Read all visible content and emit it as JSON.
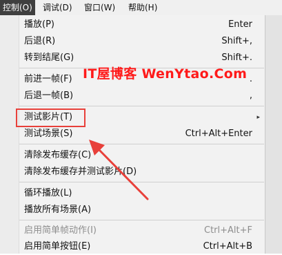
{
  "menubar": {
    "items": [
      {
        "label": "控制(O)",
        "active": true
      },
      {
        "label": "调试(D)"
      },
      {
        "label": "窗口(W)"
      },
      {
        "label": "帮助(H)"
      }
    ]
  },
  "menu": {
    "items": [
      {
        "label": "播放(P)",
        "shortcut": "Enter"
      },
      {
        "label": "后退(R)",
        "shortcut": "Shift+,"
      },
      {
        "label": "转到结尾(G)",
        "shortcut": "Shift+."
      },
      {
        "label": "前进一帧(F)",
        "shortcut": "."
      },
      {
        "label": "后退一帧(B)",
        "shortcut": ","
      },
      {
        "label": "测试影片(T)",
        "shortcut": "",
        "submenu": "submenu-arrow-icon"
      },
      {
        "label": "测试场景(S)",
        "shortcut": "Ctrl+Alt+Enter"
      },
      {
        "label": "清除发布缓存(C)",
        "shortcut": ""
      },
      {
        "label": "清除发布缓存并测试影片(D)",
        "shortcut": ""
      },
      {
        "label": "循环播放(L)",
        "shortcut": ""
      },
      {
        "label": "播放所有场景(A)",
        "shortcut": ""
      },
      {
        "label": "启用简单帧动作(I)",
        "shortcut": "Ctrl+Alt+F",
        "disabled": true
      },
      {
        "label": "启用简单按钮(E)",
        "shortcut": "Ctrl+Alt+B"
      }
    ],
    "submenu_glyph": "▸"
  },
  "annotation": {
    "watermark": "IT屋博客 WenYtao.Com",
    "highlight_color": "#e8403a",
    "arrow_color": "#e8403a"
  },
  "colors": {
    "menubar_active_bg": "#3f3f3f",
    "menu_bg": "#f2f2f2",
    "disabled_text": "#8d8d8d"
  }
}
